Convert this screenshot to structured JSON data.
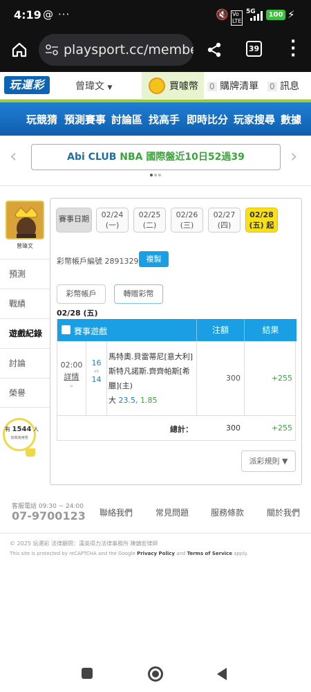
{
  "statusbar": {
    "time": "4:19",
    "battery": "100"
  },
  "browser": {
    "url": "playsport.cc/member/",
    "tab_count": "39"
  },
  "header": {
    "logo": "玩運彩",
    "username": "曾瑋文",
    "coin_label": "買噱幣",
    "cart_count": "0",
    "cart_label": "購牌清單",
    "msg_count": "0",
    "msg_label": "訊息"
  },
  "nav": {
    "items": [
      "玩競猜",
      "預測賽事",
      "討論區",
      "找高手",
      "即時比分",
      "玩家搜尋",
      "數據"
    ]
  },
  "banner": {
    "part1": "Abi CLUB",
    "part2": "NBA",
    "part3": "國際盤近10日52過39"
  },
  "sidebar": {
    "name": "曾瑋文",
    "items": [
      "預測",
      "戰績",
      "遊戲紀錄",
      "討論",
      "榮譽"
    ],
    "fans_prefix": "有",
    "fans_count": "1544",
    "fans_suffix": "人",
    "fans_note": "加我為用燈"
  },
  "dates": {
    "label": "賽事日期",
    "items": [
      {
        "date": "02/24",
        "day": "(一)"
      },
      {
        "date": "02/25",
        "day": "(二)"
      },
      {
        "date": "02/26",
        "day": "(三)"
      },
      {
        "date": "02/27",
        "day": "(四)"
      },
      {
        "date": "02/28",
        "day": "(五) 起"
      }
    ]
  },
  "account": {
    "label": "彩幣帳戶編號 28913297",
    "copy": "複製",
    "tab1": "彩幣帳戶",
    "tab2": "轉贈彩幣",
    "date_heading": "02/28 (五)"
  },
  "table": {
    "col1": "賽事遊戲",
    "col2": "注額",
    "col3": "結果",
    "row": {
      "time": "02:00",
      "detail": "詳情",
      "score1": "16",
      "vs": "vs",
      "score2": "14",
      "team1": "馬特奧.貝雷蒂尼[意大利]",
      "team2": "斯特凡諾斯.齊齊帕斯[希臘](主)",
      "bet_prefix": "大",
      "bet_line": "23.5,",
      "bet_odds": "1.85",
      "amount": "300",
      "result": "+255"
    },
    "total_label": "總計：",
    "total_amount": "300",
    "total_result": "+255"
  },
  "rules_button": "派彩規則 ▼",
  "footer": {
    "hotline_label": "客服電話 09:30 ~ 24:00",
    "hotline": "07-9700123",
    "links": [
      "聯絡我們",
      "常見問題",
      "服務條款",
      "關於我們"
    ],
    "copyright": "© 2025 玩運彩 法律顧問：漢英得力法律事務所 陳鎮宏律師",
    "recaptcha_pre": "This site is protected by reCAPTCHA and the Google",
    "privacy": "Privacy Policy",
    "and": "and",
    "terms": "Terms of Service",
    "apply": "apply."
  },
  "colors": {
    "brand_blue": "#0f5fae",
    "green_bar": "#9acb38",
    "table_head": "#1a9fe4",
    "result_green": "#3aa53a",
    "date_active": "#f7e01a"
  }
}
